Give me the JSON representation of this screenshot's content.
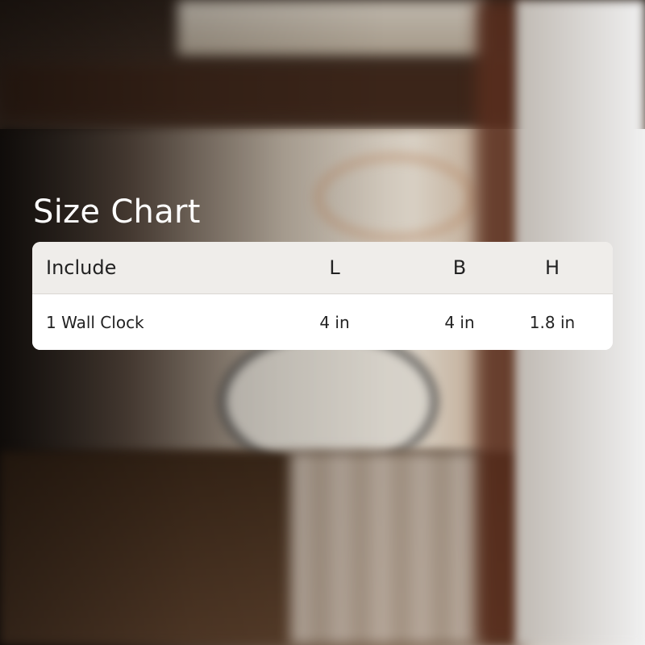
{
  "title": "Size Chart",
  "table": {
    "headers": [
      "Include",
      "L",
      "B",
      "H"
    ],
    "rows": [
      [
        "1 Wall Clock",
        "4 in",
        "4 in",
        "1.8 in"
      ]
    ]
  },
  "colors": {
    "header_bg": "#efedea",
    "body_bg": "#ffffff",
    "title_text": "#ffffff",
    "cell_text": "#222222"
  }
}
